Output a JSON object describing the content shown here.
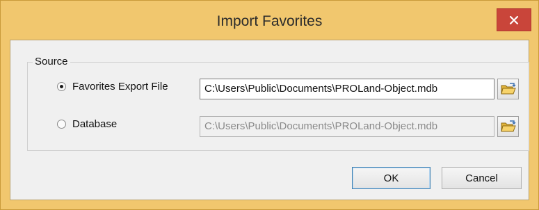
{
  "window": {
    "title": "Import Favorites",
    "close_icon": "close-icon",
    "accent_color": "#f1c76e",
    "close_color": "#c9453a"
  },
  "source_group": {
    "label": "Source",
    "options": [
      {
        "label": "Favorites Export File",
        "selected": true,
        "path": "C:\\Users\\Public\\Documents\\PROLand-Object.mdb",
        "enabled": true,
        "browse_icon": "folder-open-icon"
      },
      {
        "label": "Database",
        "selected": false,
        "path": "C:\\Users\\Public\\Documents\\PROLand-Object.mdb",
        "enabled": false,
        "browse_icon": "folder-open-icon"
      }
    ]
  },
  "buttons": {
    "ok_label": "OK",
    "cancel_label": "Cancel"
  }
}
